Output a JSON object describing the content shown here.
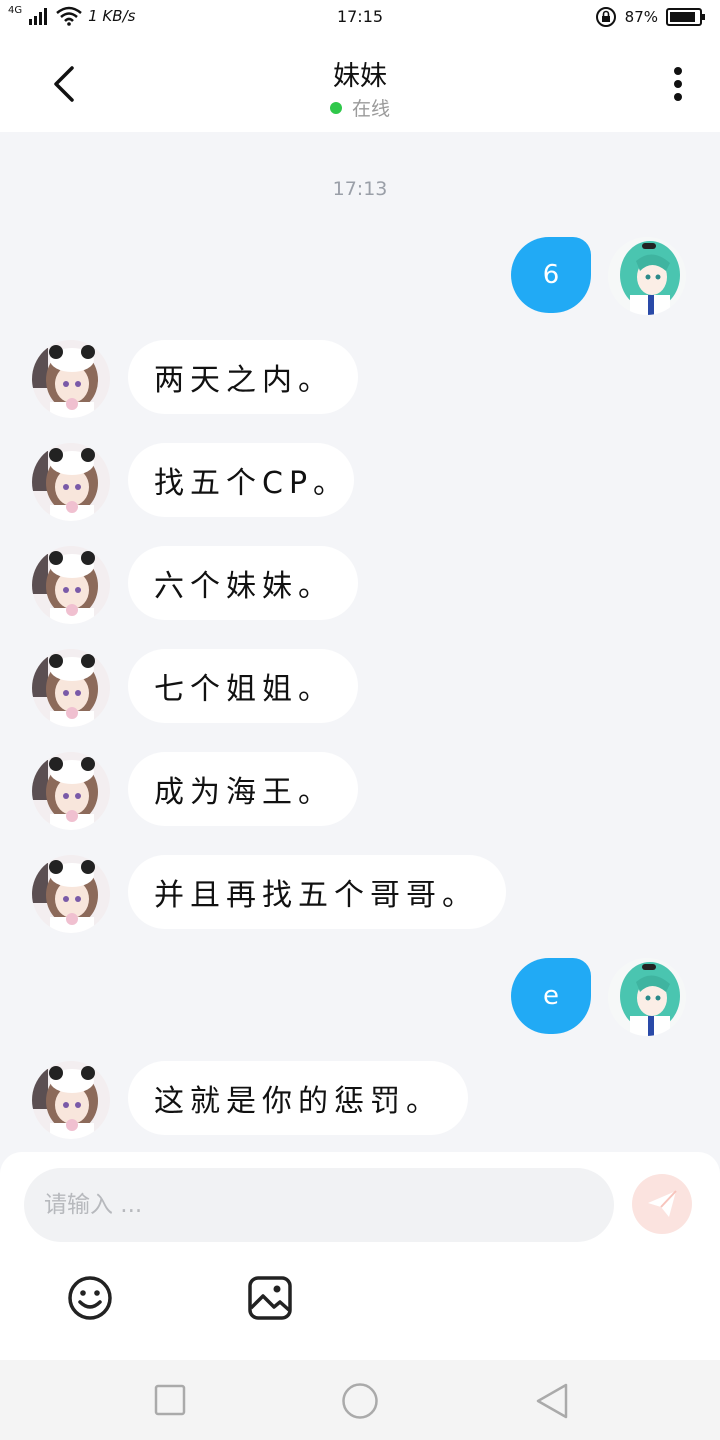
{
  "status_bar": {
    "network": "4G",
    "speed": "1 KB/s",
    "time": "17:15",
    "battery": "87%"
  },
  "header": {
    "title": "妹妹",
    "status": "在线"
  },
  "timestamp": "17:13",
  "messages": [
    {
      "side": "right",
      "text": "6"
    },
    {
      "side": "left",
      "text": "两天之内。"
    },
    {
      "side": "left",
      "text": "找五个CP。"
    },
    {
      "side": "left",
      "text": "六个妹妹。"
    },
    {
      "side": "left",
      "text": "七个姐姐。"
    },
    {
      "side": "left",
      "text": "成为海王。"
    },
    {
      "side": "left",
      "text": "并且再找五个哥哥。"
    },
    {
      "side": "right",
      "text": "e"
    },
    {
      "side": "left",
      "text": "这就是你的惩罚。"
    }
  ],
  "input": {
    "placeholder": "请输入 ..."
  },
  "colors": {
    "accent": "#21aaf5",
    "online": "#2fc84a",
    "send": "#f3a59a"
  }
}
